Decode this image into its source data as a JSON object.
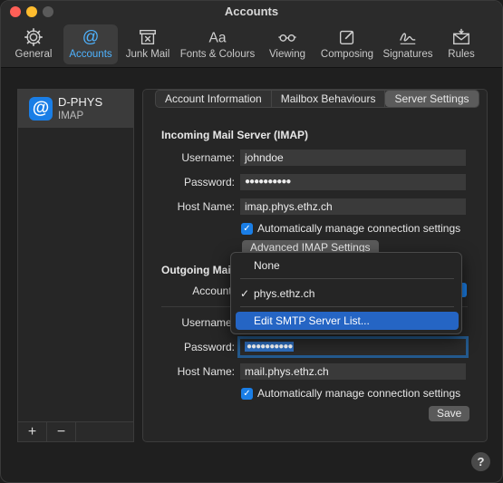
{
  "window": {
    "title": "Accounts"
  },
  "toolbar": {
    "items": [
      {
        "label": "General",
        "icon": "gear-icon"
      },
      {
        "label": "Accounts",
        "icon": "at-icon"
      },
      {
        "label": "Junk Mail",
        "icon": "junk-mail-icon"
      },
      {
        "label": "Fonts & Colours",
        "icon": "fonts-icon"
      },
      {
        "label": "Viewing",
        "icon": "glasses-icon"
      },
      {
        "label": "Composing",
        "icon": "compose-icon"
      },
      {
        "label": "Signatures",
        "icon": "signature-icon"
      },
      {
        "label": "Rules",
        "icon": "rules-icon"
      }
    ],
    "active_index": 1,
    "accent": "#4fb3ff"
  },
  "accounts": {
    "items": [
      {
        "name": "D-PHYS",
        "type": "IMAP",
        "icon_glyph": "@"
      }
    ],
    "add_label": "+",
    "remove_label": "−"
  },
  "tabs": [
    {
      "label": "Account Information"
    },
    {
      "label": "Mailbox Behaviours"
    },
    {
      "label": "Server Settings"
    }
  ],
  "incoming": {
    "title": "Incoming Mail Server (IMAP)",
    "username_label": "Username:",
    "username": "johndoe",
    "password_label": "Password:",
    "password": "●●●●●●●●●●",
    "host_label": "Host Name:",
    "host": "imap.phys.ethz.ch",
    "auto_manage_label": "Automatically manage connection settings",
    "advanced_button": "Advanced IMAP Settings"
  },
  "outgoing": {
    "title": "Outgoing Mail",
    "account_label": "Account:",
    "username_label": "Username:",
    "password_label": "Password:",
    "password": "●●●●●●●●●●",
    "host_label": "Host Name:",
    "host": "mail.phys.ethz.ch",
    "auto_manage_label": "Automatically manage connection settings",
    "save_button": "Save"
  },
  "smtp_menu": {
    "items": [
      {
        "label": "None"
      },
      {
        "label": "phys.ethz.ch",
        "checked": "✓"
      },
      {
        "label": "Edit SMTP Server List..."
      }
    ],
    "highlight_color": "#2565c4"
  },
  "help_label": "?"
}
